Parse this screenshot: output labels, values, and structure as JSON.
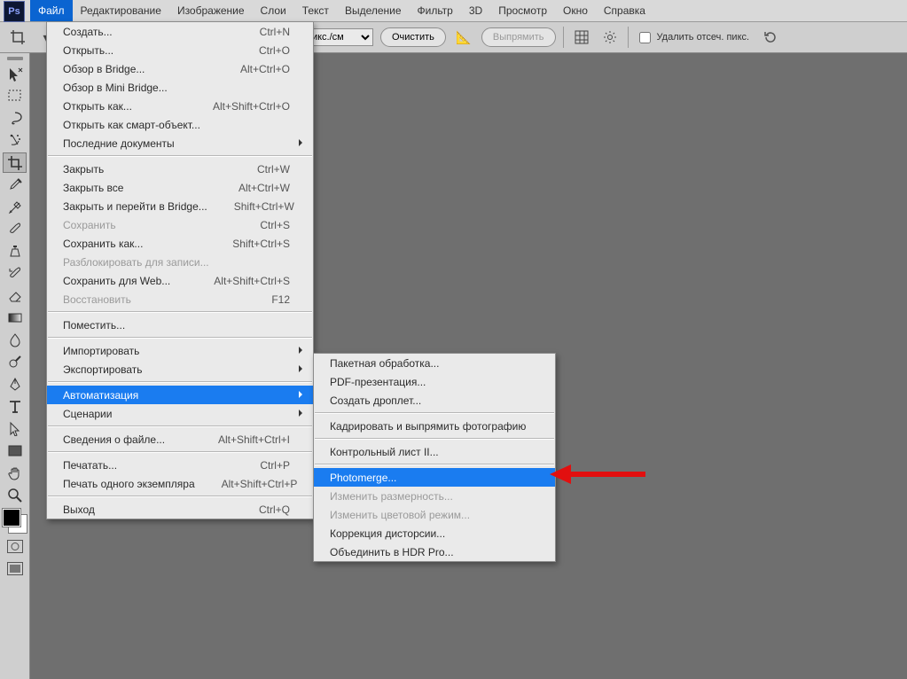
{
  "menubar": {
    "logo": "Ps",
    "items": [
      "Файл",
      "Редактирование",
      "Изображение",
      "Слои",
      "Текст",
      "Выделение",
      "Фильтр",
      "3D",
      "Просмотр",
      "Окно",
      "Справка"
    ],
    "active_index": 0
  },
  "options_bar": {
    "units_label": "пикс./см",
    "clear_btn": "Очистить",
    "straighten_btn": "Выпрямить",
    "delete_cropped_label": "Удалить отсеч. пикс."
  },
  "tools": {
    "names": [
      "move-tool",
      "marquee-tool",
      "lasso-tool",
      "quick-select-tool",
      "crop-tool",
      "eyedropper-tool",
      "healing-tool",
      "brush-tool",
      "clone-tool",
      "history-brush-tool",
      "eraser-tool",
      "gradient-tool",
      "blur-tool",
      "dodge-tool",
      "pen-tool",
      "type-tool",
      "path-select-tool",
      "rectangle-tool",
      "hand-tool",
      "zoom-tool"
    ]
  },
  "file_menu": [
    {
      "label": "Создать...",
      "shortcut": "Ctrl+N"
    },
    {
      "label": "Открыть...",
      "shortcut": "Ctrl+O"
    },
    {
      "label": "Обзор в Bridge...",
      "shortcut": "Alt+Ctrl+O"
    },
    {
      "label": "Обзор в Mini Bridge..."
    },
    {
      "label": "Открыть как...",
      "shortcut": "Alt+Shift+Ctrl+O"
    },
    {
      "label": "Открыть как смарт-объект..."
    },
    {
      "label": "Последние документы",
      "submenu": true
    },
    {
      "sep": true
    },
    {
      "label": "Закрыть",
      "shortcut": "Ctrl+W"
    },
    {
      "label": "Закрыть все",
      "shortcut": "Alt+Ctrl+W"
    },
    {
      "label": "Закрыть и перейти в Bridge...",
      "shortcut": "Shift+Ctrl+W"
    },
    {
      "label": "Сохранить",
      "shortcut": "Ctrl+S",
      "disabled": true
    },
    {
      "label": "Сохранить как...",
      "shortcut": "Shift+Ctrl+S"
    },
    {
      "label": "Разблокировать для записи...",
      "disabled": true
    },
    {
      "label": "Сохранить для Web...",
      "shortcut": "Alt+Shift+Ctrl+S"
    },
    {
      "label": "Восстановить",
      "shortcut": "F12",
      "disabled": true
    },
    {
      "sep": true
    },
    {
      "label": "Поместить..."
    },
    {
      "sep": true
    },
    {
      "label": "Импортировать",
      "submenu": true
    },
    {
      "label": "Экспортировать",
      "submenu": true
    },
    {
      "sep": true
    },
    {
      "label": "Автоматизация",
      "submenu": true,
      "hover": true
    },
    {
      "label": "Сценарии",
      "submenu": true
    },
    {
      "sep": true
    },
    {
      "label": "Сведения о файле...",
      "shortcut": "Alt+Shift+Ctrl+I"
    },
    {
      "sep": true
    },
    {
      "label": "Печатать...",
      "shortcut": "Ctrl+P"
    },
    {
      "label": "Печать одного экземпляра",
      "shortcut": "Alt+Shift+Ctrl+P"
    },
    {
      "sep": true
    },
    {
      "label": "Выход",
      "shortcut": "Ctrl+Q"
    }
  ],
  "auto_submenu": [
    {
      "label": "Пакетная обработка..."
    },
    {
      "label": "PDF-презентация..."
    },
    {
      "label": "Создать дроплет..."
    },
    {
      "sep": true
    },
    {
      "label": "Кадрировать и выпрямить фотографию"
    },
    {
      "sep": true
    },
    {
      "label": "Контрольный лист II..."
    },
    {
      "sep": true
    },
    {
      "label": "Photomerge...",
      "hover": true
    },
    {
      "label": "Изменить размерность...",
      "disabled": true
    },
    {
      "label": "Изменить цветовой режим...",
      "disabled": true
    },
    {
      "label": "Коррекция дисторсии..."
    },
    {
      "label": "Объединить в HDR Pro..."
    }
  ]
}
